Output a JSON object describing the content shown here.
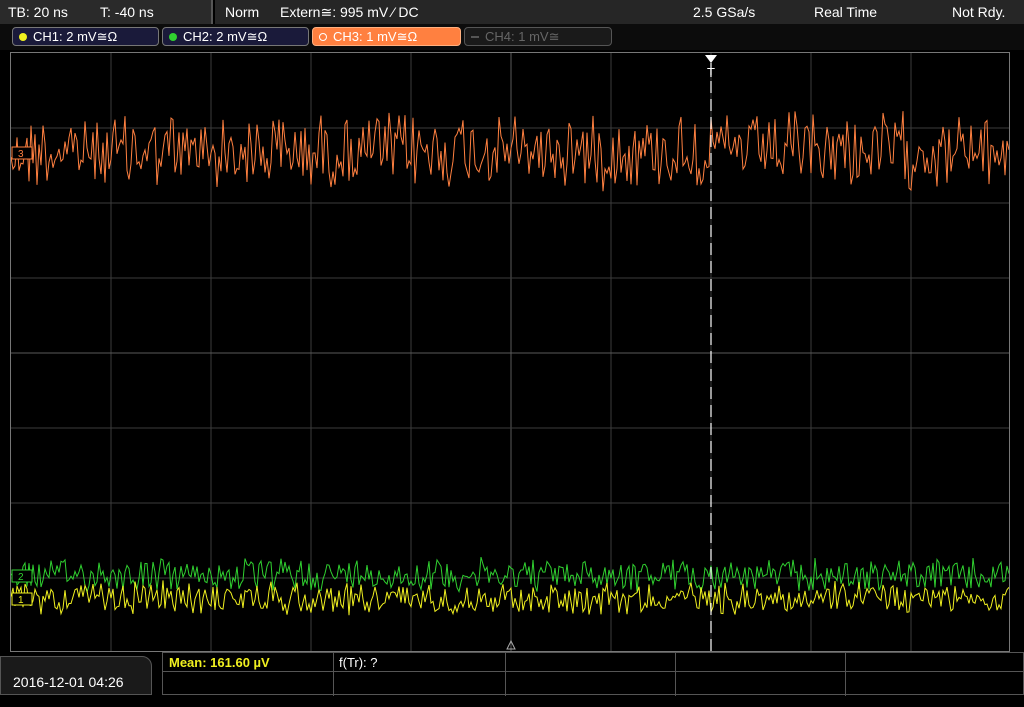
{
  "header": {
    "timebase": "TB: 20 ns",
    "trigger_time": "T: -40 ns",
    "mode": "Norm",
    "trigger_source": "Extern≅: 995 mV ⁄ DC",
    "sample_rate": "2.5 GSa/s",
    "acquisition": "Real Time",
    "status": "Not Rdy."
  },
  "channels": [
    {
      "label": "CH1: 2 mV≅Ω",
      "color": "#f0f020",
      "active": true
    },
    {
      "label": "CH2: 2 mV≅Ω",
      "color": "#30d030",
      "active": true
    },
    {
      "label": "CH3: 1 mV≅Ω",
      "color": "#ff8040",
      "active": true,
      "selected": true
    },
    {
      "label": "CH4: 1 mV≅",
      "color": "#707070",
      "active": false
    }
  ],
  "markers": {
    "ch3": "3",
    "ch2": "2",
    "ch1": "1",
    "trigger": "T"
  },
  "footer": {
    "datetime": "2016-12-01 04:26",
    "measurement_1": "Mean: 161.60 µV",
    "measurement_2": "f(Tr): ?"
  },
  "colors": {
    "grid": "#3c3c3c",
    "ch1": "#f0f020",
    "ch2": "#30d030",
    "ch3": "#ff8040",
    "trigger_line": "#ffffff"
  }
}
